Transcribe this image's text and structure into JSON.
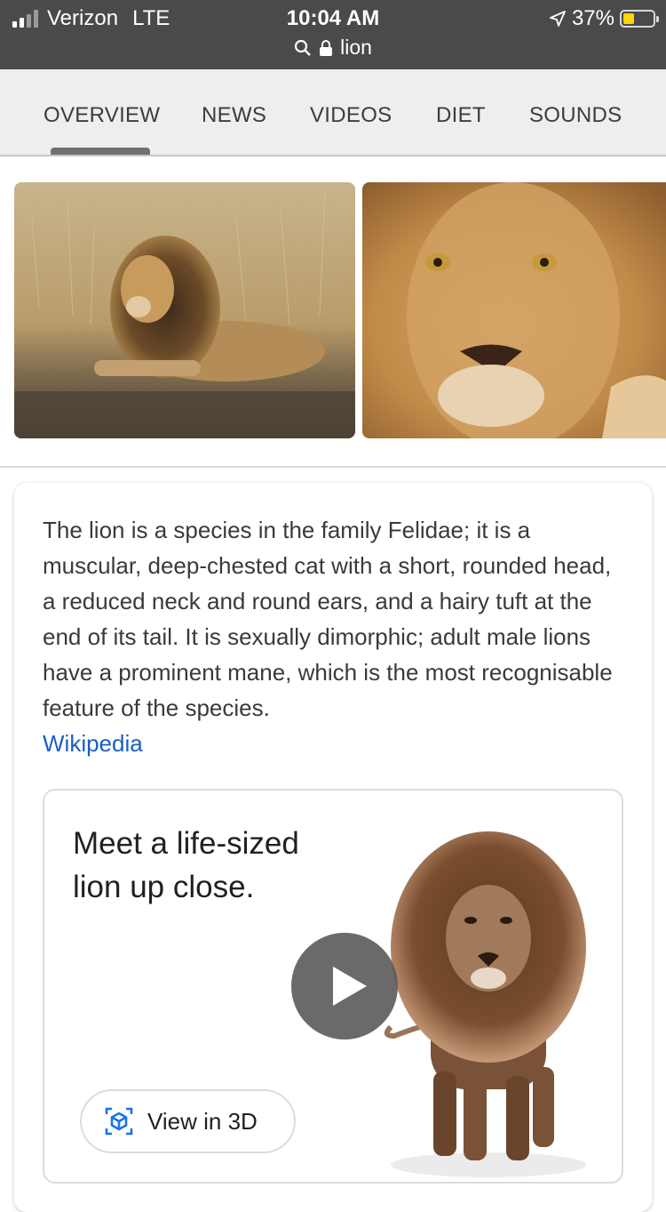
{
  "status_bar": {
    "carrier": "Verizon",
    "network": "LTE",
    "time": "10:04 AM",
    "url": "lion",
    "battery": "37%",
    "battery_level": 0.37
  },
  "tabs": [
    {
      "label": "OVERVIEW",
      "active": true
    },
    {
      "label": "NEWS"
    },
    {
      "label": "VIDEOS"
    },
    {
      "label": "DIET"
    },
    {
      "label": "SOUNDS"
    }
  ],
  "knowledge_panel": {
    "description": "The lion is a species in the family Felidae; it is a muscular, deep-chested cat with a short, rounded head, a reduced neck and round ears, and a hairy tuft at the end of its tail. It is sexually dimorphic; adult male lions have a prominent mane, which is the most recognisable feature of the species.",
    "source": "Wikipedia"
  },
  "ar_card": {
    "title": "Meet a life-sized lion up close.",
    "button_label": "View in 3D"
  },
  "colors": {
    "status_bar_bg": "#4a4a4a",
    "tab_bar_bg": "#eeeeee",
    "link": "#1a5fc4",
    "battery_fill": "#ffd60a"
  }
}
